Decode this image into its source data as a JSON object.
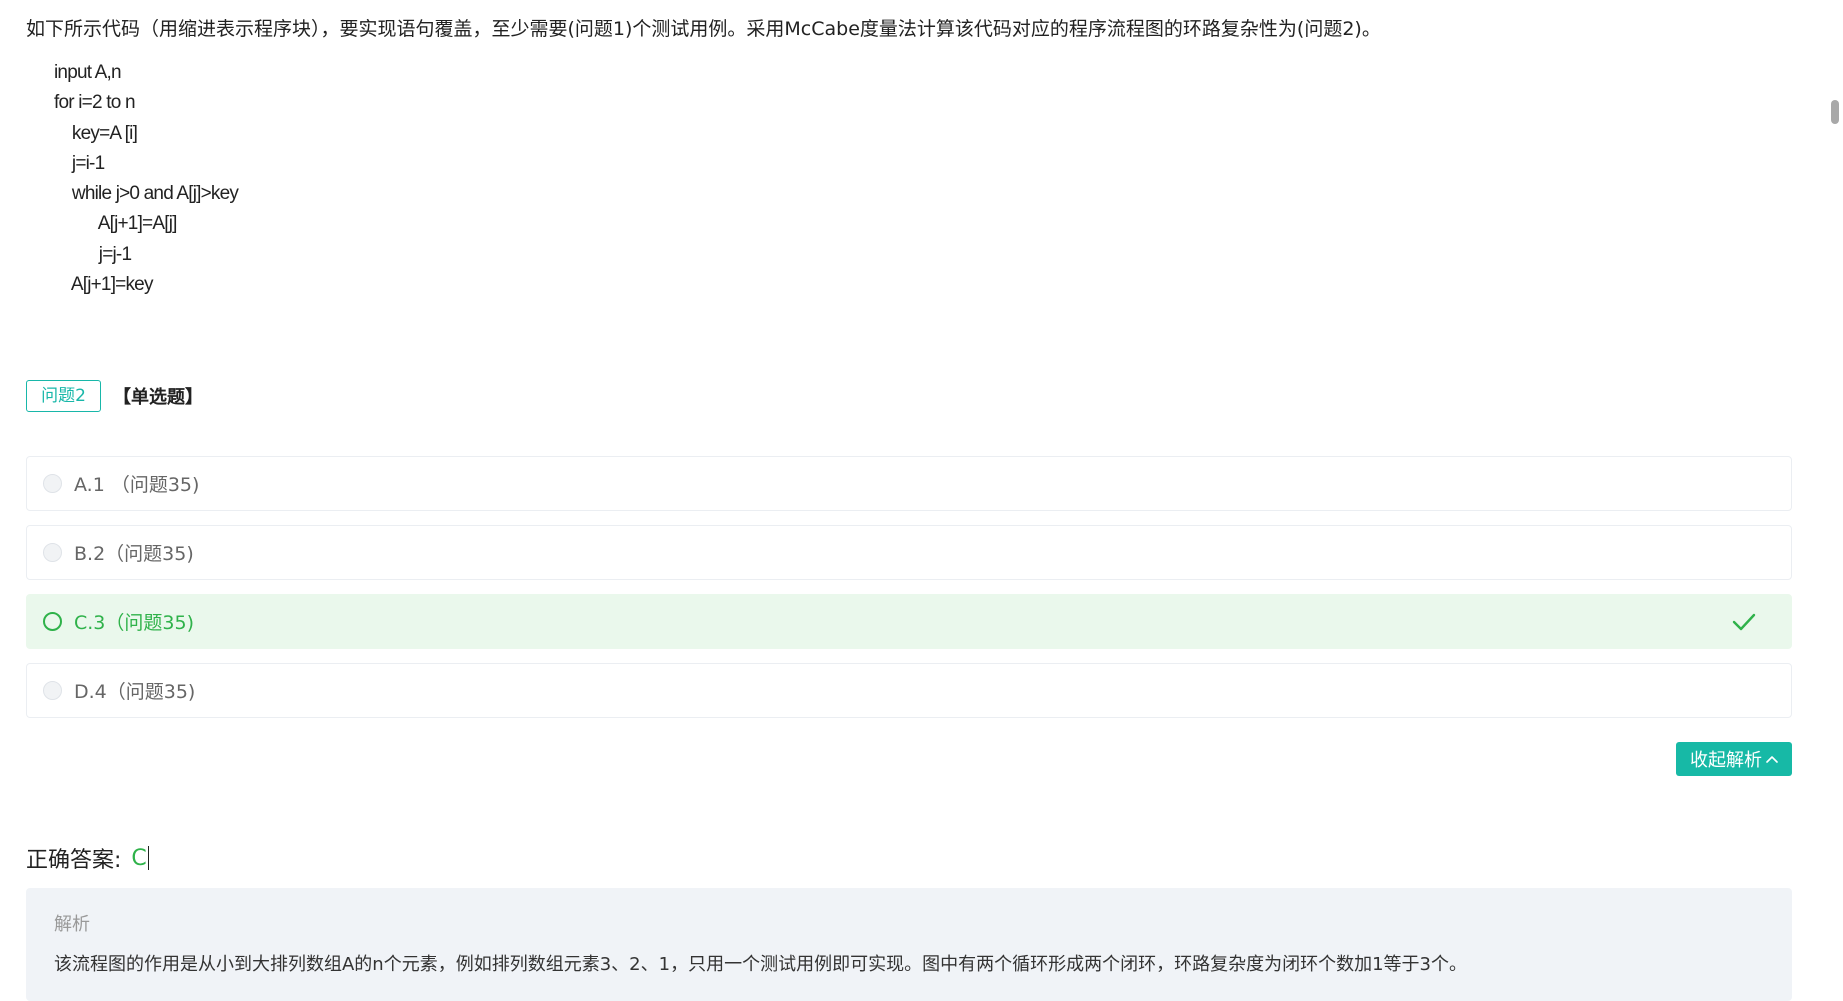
{
  "question": {
    "stem": "如下所示代码（用缩进表示程序块），要实现语句覆盖，至少需要(问题1)个测试用例。采用McCabe度量法计算该代码对应的程序流程图的环路复杂性为(问题2)。",
    "code_lines": [
      "input A,n",
      "for i=2 to n",
      "    key=A [i]",
      "    j=i-1",
      "    while j>0 and A[j]>key",
      "          A[j+1]=A[j]",
      "          j=j-1",
      "    A[j+1]=key"
    ]
  },
  "subquestion": {
    "tag": "问题2",
    "type": "【单选题】"
  },
  "options": [
    {
      "label": "A.1 （问题35)",
      "selected": false
    },
    {
      "label": "B.2（问题35)",
      "selected": false
    },
    {
      "label": "C.3（问题35)",
      "selected": true
    },
    {
      "label": "D.4（问题35)",
      "selected": false
    }
  ],
  "collapse_button": "收起解析",
  "answer": {
    "label": "正确答案:",
    "value": "C"
  },
  "analysis": {
    "title": "解析",
    "text": "该流程图的作用是从小到大排列数组A的n个元素，例如排列数组元素3、2、1，只用一个测试用例即可实现。图中有两个循环形成两个闭环，环路复杂度为闭环个数加1等于3个。"
  },
  "colors": {
    "accent": "#17b9a6",
    "correct": "#2fb24a",
    "correct_bg": "#eaf8ec"
  }
}
